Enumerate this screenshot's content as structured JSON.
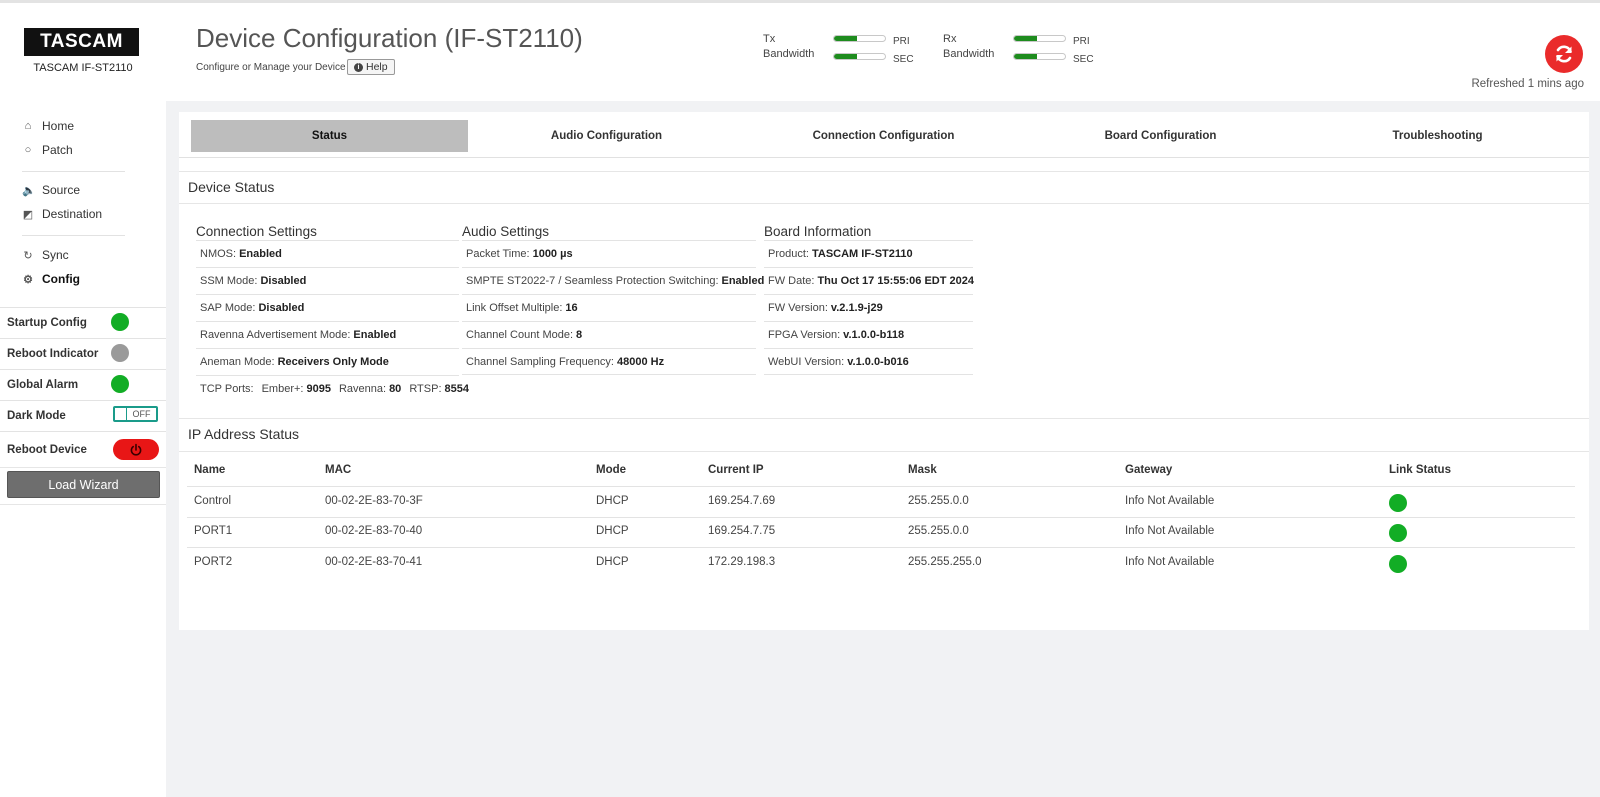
{
  "header": {
    "logo_text": "TASCAM",
    "device_name": "TASCAM IF-ST2110",
    "title": "Device Configuration (IF-ST2110)",
    "subtitle": "Configure or Manage your Device",
    "help_label": "Help",
    "refreshed_text": "Refreshed 1 mins ago",
    "bandwidth": {
      "tx": {
        "label_line1": "Tx",
        "label_line2": "Bandwidth",
        "pri_label": "PRI",
        "sec_label": "SEC",
        "pri_level": 0.45,
        "sec_level": 0.45
      },
      "rx": {
        "label_line1": "Rx",
        "label_line2": "Bandwidth",
        "pri_label": "PRI",
        "sec_label": "SEC",
        "pri_level": 0.45,
        "sec_level": 0.45
      }
    }
  },
  "sidebar": {
    "nav": [
      {
        "label": "Home",
        "icon": "home-icon"
      },
      {
        "label": "Patch",
        "icon": "patch-icon"
      },
      {
        "label": "Source",
        "icon": "speaker-icon"
      },
      {
        "label": "Destination",
        "icon": "headphones-icon"
      },
      {
        "label": "Sync",
        "icon": "sync-icon"
      },
      {
        "label": "Config",
        "icon": "gears-icon"
      }
    ],
    "startup_config": "Startup Config",
    "reboot_indicator": "Reboot Indicator",
    "global_alarm": "Global Alarm",
    "dark_mode": "Dark Mode",
    "dark_mode_state": "OFF",
    "reboot_device": "Reboot Device",
    "load_wizard": "Load Wizard",
    "colors": {
      "ok": "#12ad25",
      "inactive": "#9a9a9a",
      "danger": "#e81616"
    }
  },
  "tabs": [
    "Status",
    "Audio Configuration",
    "Connection Configuration",
    "Board Configuration",
    "Troubleshooting"
  ],
  "device_status": {
    "title": "Device Status",
    "connection": {
      "title": "Connection Settings",
      "nmos_label": "NMOS:",
      "nmos_value": "Enabled",
      "ssm_label": "SSM Mode:",
      "ssm_value": "Disabled",
      "sap_label": "SAP Mode:",
      "sap_value": "Disabled",
      "ravenna_label": "Ravenna Advertisement Mode:",
      "ravenna_value": "Enabled",
      "aneman_label": "Aneman Mode:",
      "aneman_value": "Receivers Only Mode",
      "tcp_label": "TCP Ports:",
      "ember_label": "Ember+:",
      "ember_value": "9095",
      "ravenna_port_label": "Ravenna:",
      "ravenna_port_value": "80",
      "rtsp_label": "RTSP:",
      "rtsp_value": "8554"
    },
    "audio": {
      "title": "Audio Settings",
      "packet_label": "Packet Time:",
      "packet_value": "1000 µs",
      "smpte_label": "SMPTE ST2022-7 / Seamless Protection Switching:",
      "smpte_value": "Enabled",
      "link_label": "Link Offset Multiple:",
      "link_value": "16",
      "count_label": "Channel Count Mode:",
      "count_value": "8",
      "freq_label": "Channel Sampling Frequency:",
      "freq_value": "48000 Hz"
    },
    "board": {
      "title": "Board Information",
      "product_label": "Product:",
      "product_value": "TASCAM IF-ST2110",
      "fwdate_label": "FW Date:",
      "fwdate_value": "Thu Oct 17 15:55:06 EDT 2024",
      "fwver_label": "FW Version:",
      "fwver_value": "v.2.1.9-j29",
      "fpga_label": "FPGA Version:",
      "fpga_value": "v.1.0.0-b118",
      "webui_label": "WebUI Version:",
      "webui_value": "v.1.0.0-b016"
    }
  },
  "ip_status": {
    "title": "IP Address Status",
    "columns": [
      "Name",
      "MAC",
      "Mode",
      "Current IP",
      "Mask",
      "Gateway",
      "Link Status"
    ],
    "rows": [
      [
        "Control",
        "00-02-2E-83-70-3F",
        "DHCP",
        "169.254.7.69",
        "255.255.0.0",
        "Info Not Available"
      ],
      [
        "PORT1",
        "00-02-2E-83-70-40",
        "DHCP",
        "169.254.7.75",
        "255.255.0.0",
        "Info Not Available"
      ],
      [
        "PORT2",
        "00-02-2E-83-70-41",
        "DHCP",
        "172.29.198.3",
        "255.255.255.0",
        "Info Not Available"
      ]
    ],
    "link_status": [
      "up",
      "up",
      "up"
    ]
  }
}
